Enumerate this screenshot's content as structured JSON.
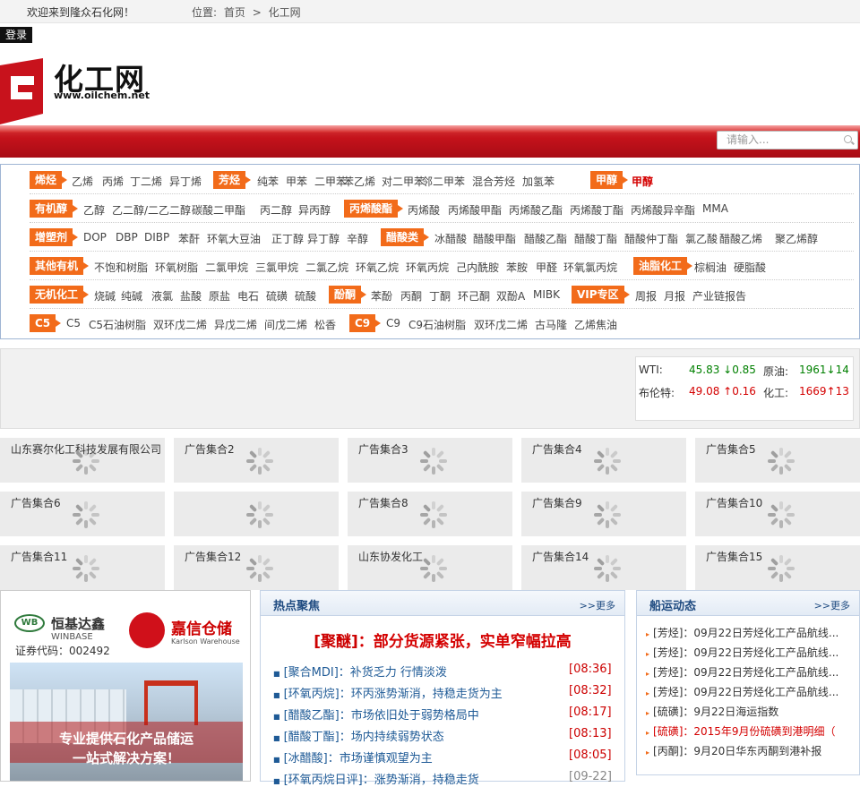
{
  "topbar": {
    "welcome": "欢迎来到隆众石化网！",
    "location_label": "位置:",
    "home": "首页",
    "sep": ">",
    "current": "化工网"
  },
  "login": "登录",
  "logo": {
    "cn": "化工网",
    "url": "www.oilchem.net"
  },
  "search": {
    "placeholder": "请输入..."
  },
  "categories": [
    {
      "tags": [
        {
          "label": "烯烃"
        },
        {
          "label": "芳烃"
        },
        {
          "label": "甲醇"
        }
      ],
      "items": [
        "乙烯",
        "丙烯",
        "丁二烯",
        "异丁烯",
        "纯苯",
        "甲苯",
        "二甲苯",
        "苯乙烯",
        "对二甲苯",
        "邻二甲苯",
        "混合芳烃",
        "加氢苯",
        "甲醇"
      ]
    },
    {
      "tags": [
        {
          "label": "有机醇"
        },
        {
          "label": "丙烯酸酯"
        }
      ],
      "items": [
        "乙醇",
        "乙二醇/二乙二醇",
        "碳酸二甲酯",
        "丙二醇",
        "异丙醇",
        "丙烯酸",
        "丙烯酸甲酯",
        "丙烯酸乙酯",
        "丙烯酸丁酯",
        "丙烯酸异辛酯",
        "MMA"
      ]
    },
    {
      "tags": [
        {
          "label": "增塑剂"
        },
        {
          "label": "醋酸类"
        }
      ],
      "items": [
        "DOP",
        "DBP",
        "DIBP",
        "苯酐",
        "环氧大豆油",
        "正丁醇",
        "异丁醇",
        "辛醇",
        "冰醋酸",
        "醋酸甲酯",
        "醋酸乙酯",
        "醋酸丁酯",
        "醋酸仲丁酯",
        "氯乙酸",
        "醋酸乙烯",
        "聚乙烯醇"
      ]
    },
    {
      "tags": [
        {
          "label": "其他有机"
        },
        {
          "label": "油脂化工"
        }
      ],
      "items": [
        "不饱和树脂",
        "环氧树脂",
        "二氯甲烷",
        "三氯甲烷",
        "二氯乙烷",
        "环氧乙烷",
        "环氧丙烷",
        "己内酰胺",
        "苯胺",
        "甲醛",
        "环氧氯丙烷",
        "棕榈油",
        "硬脂酸"
      ]
    },
    {
      "tags": [
        {
          "label": "无机化工"
        },
        {
          "label": "酚酮"
        },
        {
          "label": "VIP专区"
        }
      ],
      "items": [
        "烧碱",
        "纯碱",
        "液氯",
        "盐酸",
        "原盐",
        "电石",
        "硫磺",
        "硫酸",
        "苯酚",
        "丙酮",
        "丁酮",
        "环己酮",
        "双酚A",
        "MIBK",
        "周报",
        "月报",
        "产业链报告"
      ]
    },
    {
      "tags": [
        {
          "label": "C5"
        },
        {
          "label": "C9"
        }
      ],
      "items": [
        "C5",
        "C5石油树脂",
        "双环戊二烯",
        "异戊二烯",
        "间戊二烯",
        "松香",
        "C9",
        "C9石油树脂",
        "双环戊二烯",
        "古马隆",
        "乙烯焦油"
      ]
    }
  ],
  "prices": {
    "wti_label": "WTI:",
    "wti_val": "45.83 ↓0.85",
    "oil_label": "原油:",
    "oil_val": "1961↓14",
    "brent_label": "布伦特:",
    "brent_val": "49.08 ↑0.16",
    "chem_label": "化工:",
    "chem_val": "1669↑13",
    "colors": {
      "down": "#008000",
      "up": "#d40000"
    }
  },
  "ads": [
    "山东赛尔化工科技发展有限公司",
    "广告集合2",
    "广告集合3",
    "广告集合4",
    "广告集合5",
    "广告集合6",
    "",
    "广告集合8",
    "广告集合9",
    "广告集合10",
    "广告集合11",
    "广告集合12",
    "山东协发化工",
    "广告集合14",
    "广告集合15"
  ],
  "promo": {
    "brand1_cn": "恒基达鑫",
    "brand1_en": "WINBASE",
    "stock": "证券代码：002492",
    "brand2_cn": "嘉信仓储",
    "brand2_en": "Karlson Warehouse",
    "slogan1": "专业提供石化产品储运",
    "slogan2": "一站式解决方案！"
  },
  "hot": {
    "title": "热点聚焦",
    "more": ">>更多",
    "headline_tag": "[聚醚]",
    "headline_sep": "：",
    "headline_text": "部分货源紧张，实单窄幅拉高",
    "items": [
      {
        "tag": "[聚合MDI]",
        "text": "：补货乏力 行情淡泼",
        "time": "[08:36]"
      },
      {
        "tag": "[环氧丙烷]",
        "text": "：环丙涨势渐消，持稳走货为主",
        "time": "[08:32]"
      },
      {
        "tag": "[醋酸乙酯]",
        "text": "：市场依旧处于弱势格局中",
        "time": "[08:17]"
      },
      {
        "tag": "[醋酸丁酯]",
        "text": "：场内持续弱势状态",
        "time": "[08:13]"
      },
      {
        "tag": "[冰醋酸]",
        "text": "：市场谨慎观望为主",
        "time": "[08:05]"
      },
      {
        "tag": "[环氧丙烷日评]",
        "text": "：涨势渐消，持稳走货",
        "time": "[09-22]"
      }
    ]
  },
  "ship": {
    "title": "船运动态",
    "more": ">>更多",
    "items": [
      {
        "text": "[芳烃]：09月22日芳烃化工产品航线...",
        "red": false
      },
      {
        "text": "[芳烃]：09月22日芳烃化工产品航线...",
        "red": false
      },
      {
        "text": "[芳烃]：09月22日芳烃化工产品航线...",
        "red": false
      },
      {
        "text": "[芳烃]：09月22日芳烃化工产品航线...",
        "red": false
      },
      {
        "text": "[硫磺]：9月22日海运指数",
        "red": false
      },
      {
        "text": "[硫磺]：2015年9月份硫磺到港明细（",
        "red": true
      },
      {
        "text": "[丙酮]：9月20日华东丙酮到港补报",
        "red": false
      }
    ]
  }
}
